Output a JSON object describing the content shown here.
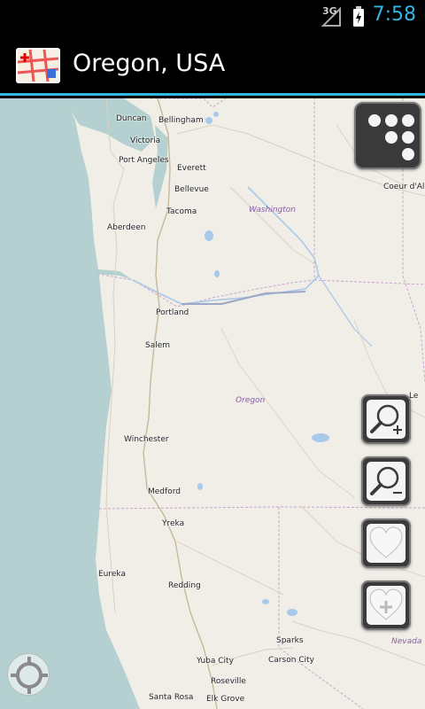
{
  "status_bar": {
    "network": "3G",
    "time": "7:58"
  },
  "action_bar": {
    "title": "Oregon, USA"
  },
  "map": {
    "cities": [
      {
        "name": "Duncan"
      },
      {
        "name": "Bellingham"
      },
      {
        "name": "Victoria"
      },
      {
        "name": "Port Angeles"
      },
      {
        "name": "Everett"
      },
      {
        "name": "Bellevue"
      },
      {
        "name": "Tacoma"
      },
      {
        "name": "Coeur d'Ale"
      },
      {
        "name": "Aberdeen"
      },
      {
        "name": "Portland"
      },
      {
        "name": "Salem"
      },
      {
        "name": "Winchester"
      },
      {
        "name": "Medford"
      },
      {
        "name": "Yreka"
      },
      {
        "name": "Eureka"
      },
      {
        "name": "Redding"
      },
      {
        "name": "Sparks"
      },
      {
        "name": "Carson City"
      },
      {
        "name": "Yuba City"
      },
      {
        "name": "Roseville"
      },
      {
        "name": "Santa Rosa"
      },
      {
        "name": "Elk Grove"
      },
      {
        "name": "Le"
      }
    ],
    "states": [
      {
        "name": "Washington"
      },
      {
        "name": "Oregon"
      },
      {
        "name": "Nevada"
      }
    ]
  },
  "controls": {
    "layers": "layers-icon",
    "zoom_in": "zoom-in-icon",
    "zoom_out": "zoom-out-icon",
    "favorite": "heart-icon",
    "add_favorite": "heart-add-icon",
    "locate": "crosshair-icon"
  }
}
